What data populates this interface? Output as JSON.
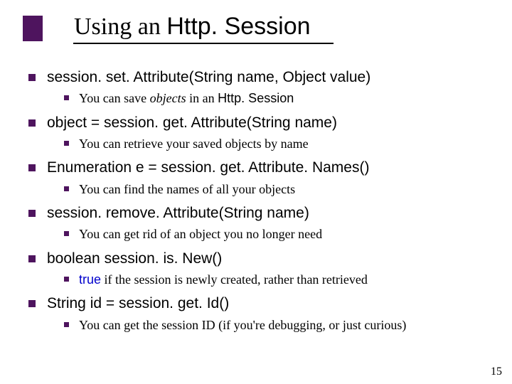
{
  "title": {
    "prefix": "Using an ",
    "code": "Http. Session"
  },
  "items": [
    {
      "l1_pre": "session. set. Attribute(String name, Object value)",
      "l2_pre": "You can save ",
      "l2_italic": "objects",
      "l2_mid": " in an ",
      "l2_code": "Http. Session"
    },
    {
      "l1_pre": "object = session. get. Attribute(String name)",
      "l2_plain": "You can retrieve your saved objects by name"
    },
    {
      "l1_pre": "Enumeration e = session. get. Attribute. Names()",
      "l2_plain": "You can find the names of all your objects"
    },
    {
      "l1_pre": "session. remove. Attribute(String name)",
      "l2_plain": "You can get rid of an object you no longer need"
    },
    {
      "l1_pre": "boolean session. is. New()",
      "l2_kw": "true",
      "l2_tail": " if the session is newly created, rather than retrieved"
    },
    {
      "l1_pre": "String id = session. get. Id()",
      "l2_plain": "You can get the session ID (if you're debugging, or just curious)"
    }
  ],
  "page_number": "15"
}
